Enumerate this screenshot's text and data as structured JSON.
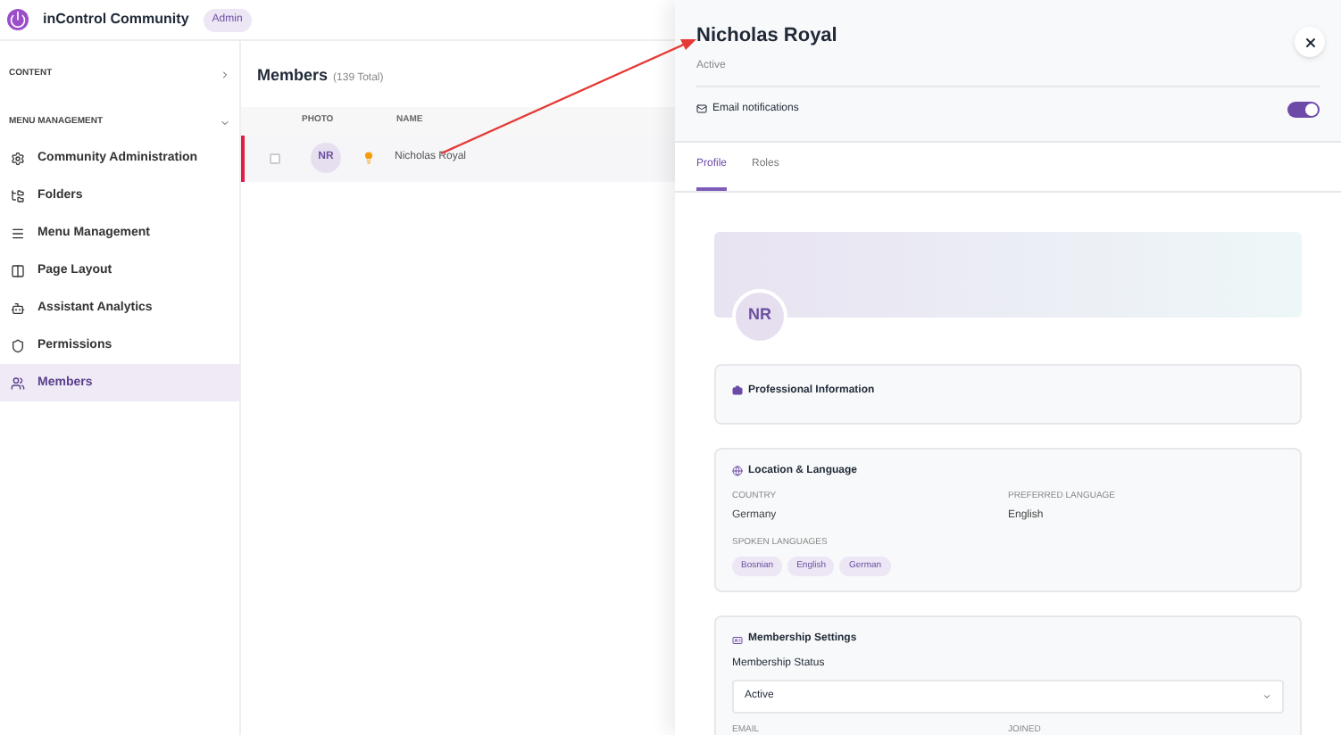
{
  "header": {
    "title": "inControl Community",
    "badge": "Admin"
  },
  "sidebar": {
    "sections": [
      {
        "label": "CONTENT",
        "expanded": false
      },
      {
        "label": "MENU MANAGEMENT",
        "expanded": true,
        "items": [
          {
            "label": "Community Administration",
            "selected": false
          },
          {
            "label": "Folders",
            "selected": false
          },
          {
            "label": "Menu Management",
            "selected": false
          },
          {
            "label": "Page Layout",
            "selected": false
          },
          {
            "label": "Assistant Analytics",
            "selected": false
          },
          {
            "label": "Permissions",
            "selected": false
          },
          {
            "label": "Members",
            "selected": true
          }
        ]
      }
    ]
  },
  "members": {
    "title": "Members",
    "count": "(139 Total)",
    "columns": [
      "PHOTO",
      "NAME"
    ],
    "rows": [
      {
        "initials": "NR",
        "name": "Nicholas Royal",
        "selected": true,
        "checked": false
      }
    ]
  },
  "panel": {
    "name": "Nicholas Royal",
    "status": "Active",
    "email_notifications": {
      "label": "Email notifications",
      "on": true
    },
    "tabs": [
      {
        "label": "Profile",
        "selected": true
      },
      {
        "label": "Roles",
        "selected": false
      }
    ],
    "avatar": "NR",
    "professional": {
      "title": "Professional Information"
    },
    "location": {
      "title": "Location & Language",
      "fields": [
        {
          "label": "COUNTRY",
          "value": "Germany"
        },
        {
          "label": "PREFERRED LANGUAGE",
          "value": "English"
        }
      ],
      "spoken_label": "SPOKEN LANGUAGES",
      "spoken": [
        "Bosnian",
        "English",
        "German"
      ]
    },
    "membership": {
      "title": "Membership Settings",
      "status_label": "Membership Status",
      "status_value": "Active",
      "fields": [
        "EMAIL",
        "JOINED"
      ]
    }
  }
}
